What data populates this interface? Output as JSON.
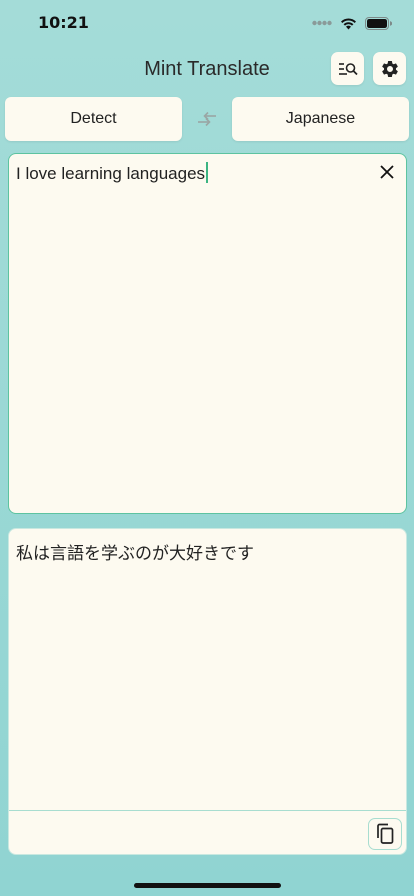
{
  "status_bar": {
    "time": "10:21"
  },
  "header": {
    "title": "Mint Translate",
    "history_icon": "search-list-icon",
    "settings_icon": "gear-icon"
  },
  "languages": {
    "source": "Detect",
    "target": "Japanese",
    "swap_icon": "swap-arrows-icon"
  },
  "input": {
    "text": "I love learning languages",
    "clear_icon": "close-icon"
  },
  "output": {
    "text": "私は言語を学ぶのが大好きです",
    "copy_icon": "copy-icon"
  },
  "colors": {
    "background": "#9ad8d5",
    "panel": "#fdfaf0",
    "accent": "#3cb482"
  }
}
